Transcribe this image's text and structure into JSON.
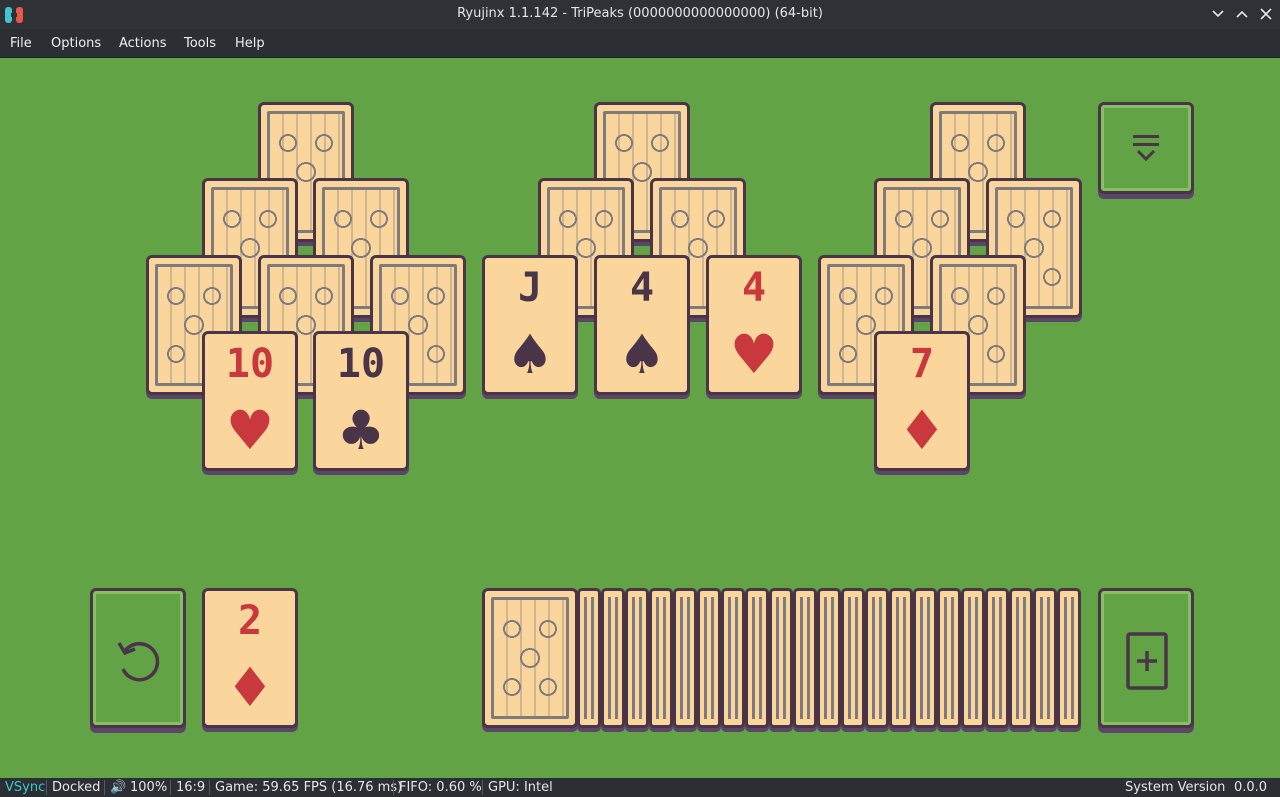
{
  "window": {
    "title": "Ryujinx 1.1.142 - TriPeaks (0000000000000000) (64-bit)",
    "buttons": [
      "chevron-down-icon",
      "chevron-up-icon",
      "close-icon"
    ]
  },
  "menu": {
    "file": "File",
    "options": "Options",
    "actions": "Actions",
    "tools": "Tools",
    "help": "Help"
  },
  "game": {
    "background_color": "#62a346",
    "card_face_color": "#fad59c",
    "red_suit_color": "#c8383c",
    "dark_suit_color": "#4a3448",
    "face_up_cards": {
      "peak1_left": {
        "rank": "10",
        "suit": "♥",
        "color": "red"
      },
      "peak1_right": {
        "rank": "10",
        "suit": "♣",
        "color": "dark"
      },
      "peak2_left": {
        "rank": "J",
        "suit": "♠",
        "color": "dark"
      },
      "peak2_mid": {
        "rank": "4",
        "suit": "♠",
        "color": "dark"
      },
      "peak2_right": {
        "rank": "4",
        "suit": "♥",
        "color": "red"
      },
      "peak3": {
        "rank": "7",
        "suit": "♦",
        "color": "red"
      },
      "waste": {
        "rank": "2",
        "suit": "♦",
        "color": "red"
      }
    },
    "buttons": {
      "menu": "menu-collapse-icon",
      "undo": "undo-icon",
      "new_card": "add-card-icon"
    }
  },
  "status": {
    "vsync": "VSync",
    "docked": "Docked",
    "volume": "100%",
    "aspect": "16:9",
    "game_fps": "Game: 59.65 FPS (16.76 ms)",
    "fifo": "FIFO: 0.60 %",
    "gpu": "GPU: Intel",
    "system_version_label": "System Version",
    "system_version": "0.0.0",
    "vsync_color": "#3fc7d0"
  }
}
